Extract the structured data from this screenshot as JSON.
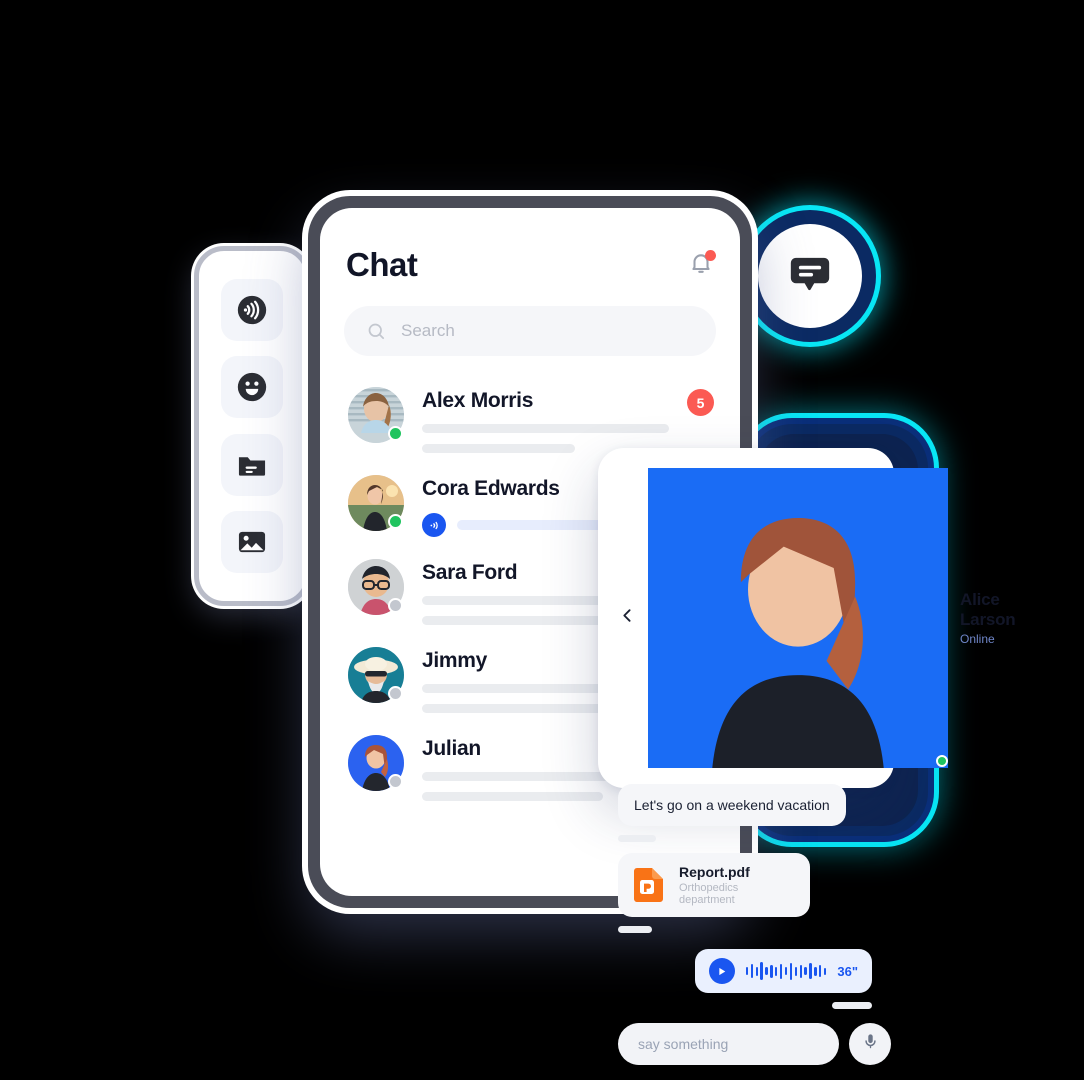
{
  "app": {
    "title": "Chat"
  },
  "header": {
    "title": "Chat",
    "bell_icon": "bell-icon",
    "has_notification": true,
    "notification_color": "#fb5a53"
  },
  "search": {
    "placeholder": "Search",
    "value": "",
    "icon": "search-icon"
  },
  "sidebar": {
    "items": [
      {
        "icon": "voice-wave-icon",
        "label": "Voice"
      },
      {
        "icon": "smiley-icon",
        "label": "Emoji"
      },
      {
        "icon": "folder-icon",
        "label": "Files"
      },
      {
        "icon": "image-icon",
        "label": "Photos"
      }
    ]
  },
  "badge": {
    "icon": "chat-bubble-icon",
    "ring_color": "#08e6f5",
    "core_color": "#0b2a63"
  },
  "chat_list": [
    {
      "name": "Alex Morris",
      "presence": "online",
      "unread": "5",
      "preview_type": "skeleton",
      "avatar_tone": "#cfd8df"
    },
    {
      "name": "Cora Edwards",
      "presence": "online",
      "unread": "",
      "preview_type": "voice",
      "avatar_tone": "#d9b894"
    },
    {
      "name": "Sara Ford",
      "presence": "offline",
      "unread": "",
      "preview_type": "skeleton",
      "avatar_tone": "#c7cbd2"
    },
    {
      "name": "Jimmy",
      "presence": "offline",
      "unread": "",
      "preview_type": "skeleton",
      "avatar_tone": "#1a7f96"
    },
    {
      "name": "Julian",
      "presence": "offline",
      "unread": "",
      "preview_type": "skeleton",
      "avatar_tone": "#2563f0"
    }
  ],
  "conversation": {
    "back_icon": "chevron-left-icon",
    "contact_name": "Alice Larson",
    "contact_status": "Online",
    "status_color": "#6f86c9",
    "messages": [
      {
        "type": "text",
        "text": "Let's go on a weekend vacation"
      }
    ],
    "attachment": {
      "icon": "pdf-file-icon",
      "name": "Report.pdf",
      "subtitle": "Orthopedics department",
      "icon_color": "#f97316"
    },
    "voice_message": {
      "play_icon": "play-icon",
      "duration": "36\"",
      "accent": "#1a56f0",
      "bars": [
        8,
        14,
        9,
        18,
        8,
        13,
        9,
        15,
        8,
        17,
        9,
        13,
        8,
        16,
        9,
        12,
        7
      ]
    },
    "composer": {
      "placeholder": "say something",
      "value": "",
      "mic_icon": "microphone-icon"
    }
  },
  "theme": {
    "background": "#000000",
    "accent_blue": "#1a56f0",
    "cyan": "#08e6f5",
    "navy": "#0b2a63",
    "red": "#fb5a53",
    "green": "#20c45f",
    "text_dark": "#121628",
    "surface": "#f5f6f9"
  }
}
